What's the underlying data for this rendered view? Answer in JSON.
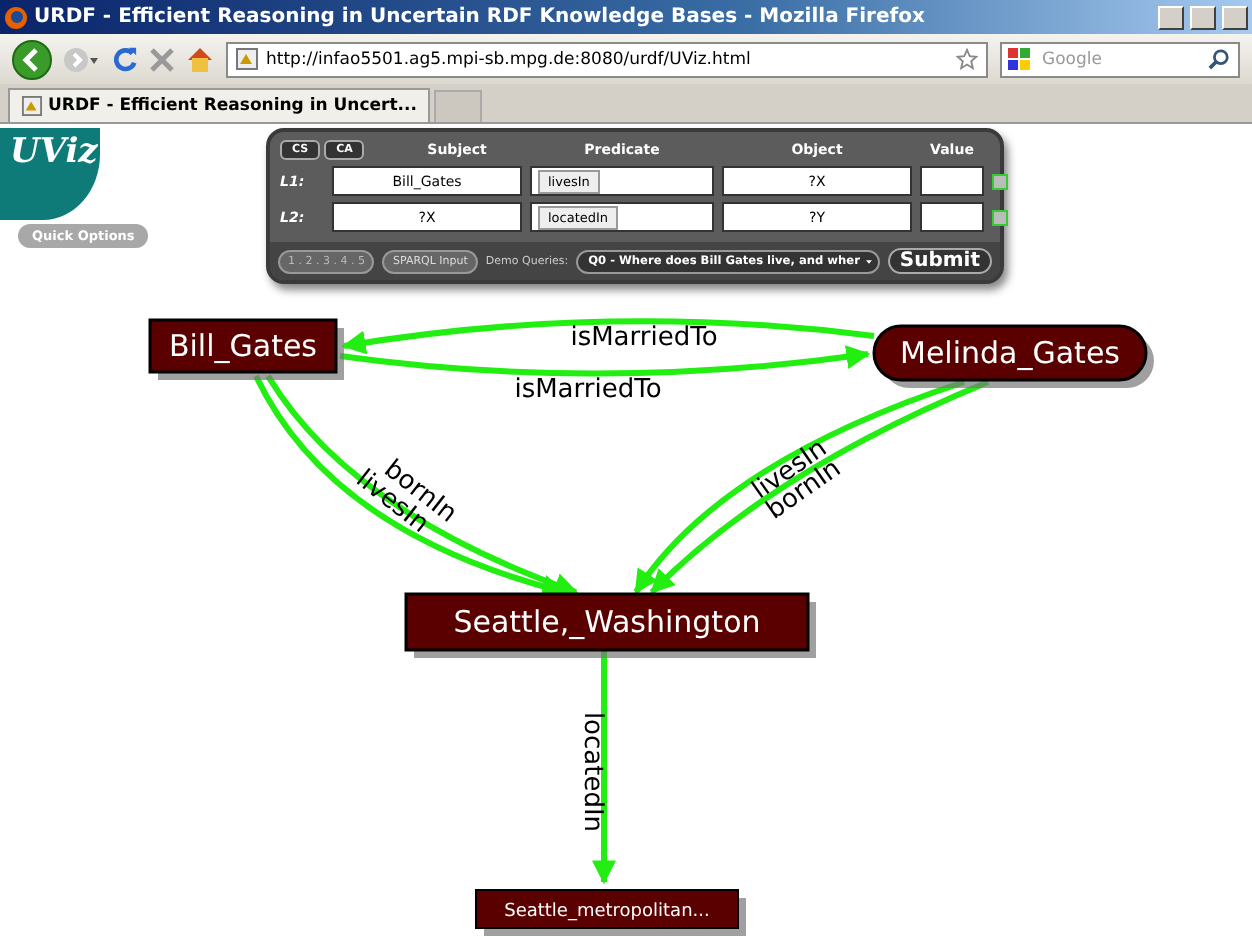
{
  "window": {
    "title": "URDF - Efficient Reasoning in Uncertain RDF Knowledge Bases - Mozilla Firefox"
  },
  "toolbar": {
    "url": "http://infao5501.ag5.mpi-sb.mpg.de:8080/urdf/UViz.html",
    "search_placeholder": "Google"
  },
  "tabs": [
    {
      "label": "URDF - Efficient Reasoning in Uncert...",
      "selected": true
    }
  ],
  "app": {
    "logo": "UViz",
    "quick_options": "Quick Options"
  },
  "query_panel": {
    "mode_buttons": [
      "CS",
      "CA"
    ],
    "columns": [
      "Subject",
      "Predicate",
      "Object",
      "Value"
    ],
    "rows": [
      {
        "label": "L1:",
        "subject": "Bill_Gates",
        "predicate": "livesIn",
        "object": "?X",
        "checked": false
      },
      {
        "label": "L2:",
        "subject": "?X",
        "predicate": "locatedIn",
        "object": "?Y",
        "checked": false
      }
    ],
    "pager": "1 . 2 . 3 . 4 . 5",
    "sparql_button": "SPARQL Input",
    "demo_label": "Demo Queries:",
    "demo_query": "Q0 - Where does Bill Gates live, and wher",
    "submit": "Submit"
  },
  "graph": {
    "nodes": [
      {
        "label": "Bill_Gates",
        "kind": "box"
      },
      {
        "label": "Melinda_Gates",
        "kind": "pill"
      },
      {
        "label": "Seattle,_Washington",
        "kind": "box"
      },
      {
        "label": "Seattle_metropolitan...",
        "kind": "small"
      }
    ],
    "edges": [
      {
        "label": "isMarriedTo"
      },
      {
        "label": "isMarriedTo"
      },
      {
        "label": "bornIn"
      },
      {
        "label": "livesIn"
      },
      {
        "label": "livesIn"
      },
      {
        "label": "bornIn"
      },
      {
        "label": "locatedIn"
      }
    ]
  }
}
